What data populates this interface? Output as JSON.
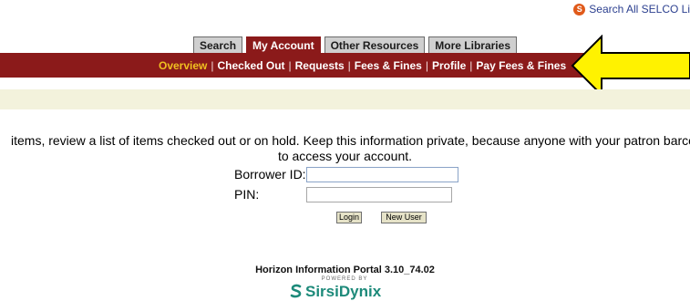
{
  "top_link": {
    "label": "Search All SELCO Li",
    "icon": "selco-logo-icon"
  },
  "tabs": [
    {
      "label": "Search",
      "active": false
    },
    {
      "label": "My Account",
      "active": true
    },
    {
      "label": "Other Resources",
      "active": false
    },
    {
      "label": "More Libraries",
      "active": false
    }
  ],
  "subnav": [
    {
      "label": "Overview",
      "current": true
    },
    {
      "label": "Checked Out",
      "current": false
    },
    {
      "label": "Requests",
      "current": false
    },
    {
      "label": "Fees & Fines",
      "current": false
    },
    {
      "label": "Profile",
      "current": false
    },
    {
      "label": "Pay Fees & Fines",
      "current": false
    }
  ],
  "intro": {
    "line1": "items, review a list of items checked out or on hold. Keep this information private, because anyone with your patron barcod",
    "line2": "to access your account."
  },
  "form": {
    "borrower_label": "Borrower ID:",
    "borrower_value": "",
    "pin_label": "PIN:",
    "pin_value": "",
    "login_label": "Login",
    "new_user_label": "New User"
  },
  "footer": {
    "portal_text": "Horizon Information Portal 3.10_74.02",
    "powered_by": "POWERED BY",
    "logo_word": "SirsiDynix"
  },
  "colors": {
    "nav_bar": "#8b1a1a",
    "current_link": "#f0c020",
    "arrow_fill": "#fff200",
    "beige_band": "#f3f2dc",
    "logo": "#1d8a7a"
  }
}
